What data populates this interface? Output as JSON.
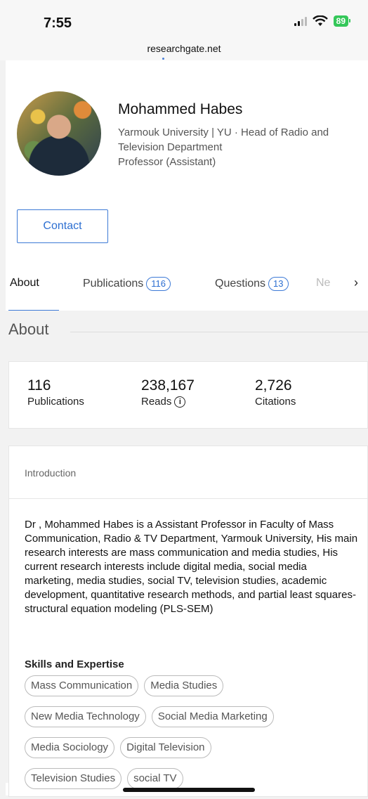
{
  "status_bar": {
    "time": "7:55",
    "battery": "89",
    "url": "researchgate.net"
  },
  "profile": {
    "name": "Mohammed Habes",
    "affiliation_line1": "Yarmouk University | YU · Head of Radio and",
    "affiliation_line2": "Television Department",
    "position": "Professor (Assistant)",
    "contact_label": "Contact"
  },
  "tabs": {
    "about": "About",
    "publications": "Publications",
    "publications_count": "116",
    "questions": "Questions",
    "questions_count": "13",
    "more": "Ne"
  },
  "about": {
    "title": "About",
    "stats": [
      {
        "value": "116",
        "label": "Publications"
      },
      {
        "value": "238,167",
        "label": "Reads"
      },
      {
        "value": "2,726",
        "label": "Citations"
      }
    ]
  },
  "introduction": {
    "heading": "Introduction",
    "text": "Dr , Mohammed Habes is a Assistant Professor in Faculty of Mass Communication, Radio & TV Department, Yarmouk University, His main research interests are mass communication and media studies, His current research interests include digital media, social media marketing, media studies, social TV, television studies, academic development, quantitative research methods, and partial least squares-structural equation modeling (PLS-SEM)",
    "skills_title": "Skills and Expertise",
    "skills": [
      [
        "Mass Communication",
        "Media Studies"
      ],
      [
        "New Media Technology",
        "Social Media Marketing"
      ],
      [
        "Media Sociology",
        "Digital Television"
      ],
      [
        "Television Studies",
        "social TV"
      ]
    ]
  }
}
